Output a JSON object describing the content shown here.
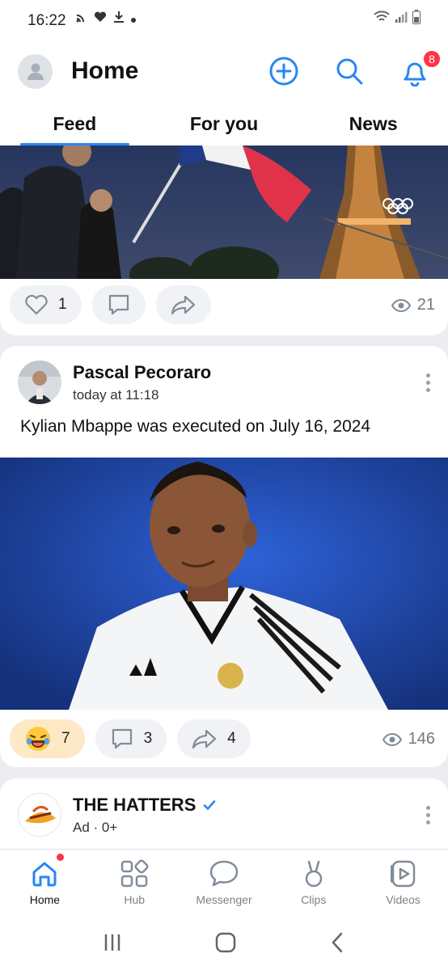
{
  "status_bar": {
    "time": "16:22"
  },
  "header": {
    "title": "Home",
    "notification_count": "8"
  },
  "tabs": [
    {
      "label": "Feed"
    },
    {
      "label": "For you"
    },
    {
      "label": "News"
    }
  ],
  "posts": [
    {
      "likes": "1",
      "views": "21"
    },
    {
      "author": "Pascal Pecoraro",
      "time": "today at 11:18",
      "text": "Kylian Mbappe was executed on July 16, 2024",
      "reactions": "7",
      "comments": "3",
      "shares": "4",
      "views": "146"
    },
    {
      "author": "THE HATTERS",
      "meta": "Ad · 0+"
    }
  ],
  "bottom_nav": [
    {
      "label": "Home"
    },
    {
      "label": "Hub"
    },
    {
      "label": "Messenger"
    },
    {
      "label": "Clips"
    },
    {
      "label": "Videos"
    }
  ],
  "colors": {
    "accent": "#2787f5",
    "badge": "#ff3347"
  }
}
